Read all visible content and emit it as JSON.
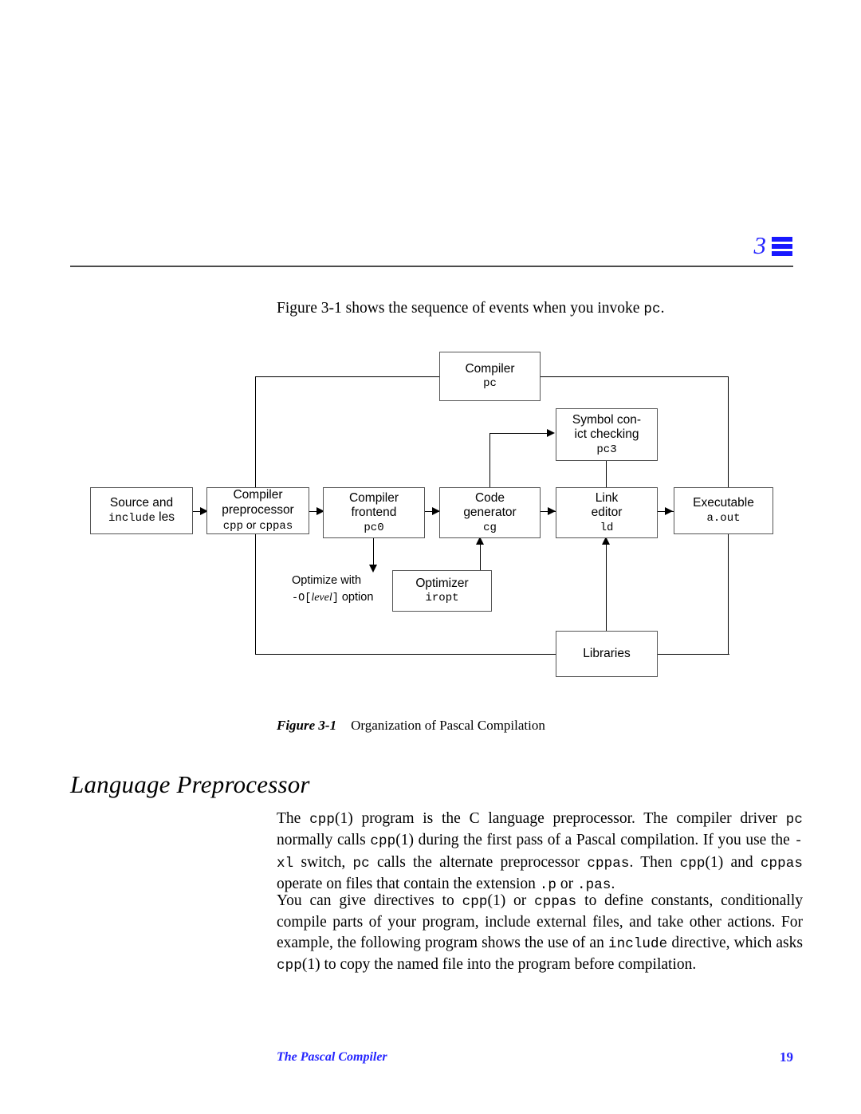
{
  "header": {
    "chapter_number": "3"
  },
  "intro": {
    "prefix": "Figure 3-1 shows the sequence of events when you invoke ",
    "code": "pc",
    "suffix": "."
  },
  "figure": {
    "boxes": [
      {
        "id": "source",
        "line1": "Source and",
        "line2": "include",
        "line2b": " les",
        "code": ""
      },
      {
        "id": "preprocessor",
        "line1": "Compiler",
        "line2": "preprocessor",
        "code": "cpp",
        "code_mid": " or ",
        "code2": "cppas"
      },
      {
        "id": "frontend",
        "line1": "Compiler",
        "line2": "frontend",
        "code": "pc0"
      },
      {
        "id": "codegen",
        "line1": "Code",
        "line2": "generator",
        "code": "cg"
      },
      {
        "id": "linkeditor",
        "line1": "Link",
        "line2": "editor",
        "code": "ld"
      },
      {
        "id": "executable",
        "line1": "Executable",
        "line2": "",
        "code": "a.out"
      },
      {
        "id": "compiler",
        "line1": "Compiler",
        "line2": "",
        "code": "pc"
      },
      {
        "id": "symbolcheck",
        "line1": "Symbol con-",
        "line2": "ict checking",
        "code": "pc3"
      },
      {
        "id": "optimizer",
        "line1": "Optimizer",
        "line2": "",
        "code": "iropt"
      },
      {
        "id": "libraries",
        "line1": "Libraries",
        "line2": "",
        "code": ""
      }
    ],
    "note": {
      "line1": "Optimize with",
      "opt": "-O",
      "bracket_open": "[",
      "level": "level",
      "bracket_close": "]",
      "line2_tail": " option"
    }
  },
  "caption": {
    "number": "Figure 3-1",
    "text": "Organization of Pascal Compilation"
  },
  "heading": {
    "title": "Language Preprocessor"
  },
  "paragraphs": {
    "p1": {
      "s1": "The ",
      "c1": "cpp",
      "s2": "(1) program is the C language preprocessor.  The compiler driver ",
      "c2": "pc",
      "s3": " normally calls ",
      "c3": "cpp",
      "s4": "(1) during the first pass of a Pascal compilation.  If you use the ",
      "c4": "-xl",
      "s5": " switch, ",
      "c5": "pc",
      "s6": " calls the alternate preprocessor ",
      "c6": "cppas",
      "s7": ".  Then ",
      "c7": "cpp",
      "s8": "(1) and ",
      "c8": "cppas",
      "s9": " operate on files that contain the extension ",
      "c9": ".p",
      "s10": " or ",
      "c10": ".pas",
      "s11": "."
    },
    "p2": {
      "s1": "You can give directives to ",
      "c1": "cpp",
      "s2": "(1) or ",
      "c2": "cppas",
      "s3": " to define constants, conditionally compile parts of your program, include external files, and take other actions.  For example, the following program shows the use of an ",
      "c3": "include",
      "s4": " directive, which asks ",
      "c4": "cpp",
      "s5": "(1) to copy the named file into the program before compilation."
    }
  },
  "footer": {
    "title": "The Pascal Compiler",
    "page": "19"
  },
  "colors": {
    "accent_blue": "#2424ff",
    "rule_gray": "#4c4c4c",
    "box_border": "#555555"
  }
}
